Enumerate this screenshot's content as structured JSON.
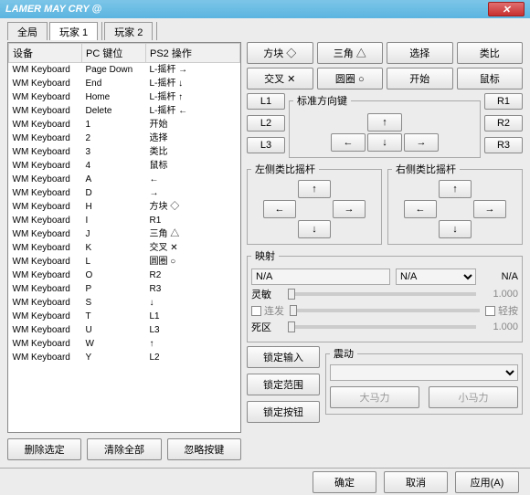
{
  "title": "LAMER MAY CRY @",
  "tabs": [
    "全局",
    "玩家 1",
    "玩家 2"
  ],
  "active_tab": 1,
  "columns": {
    "device": "设备",
    "pckey": "PC 键位",
    "ps2op": "PS2 操作"
  },
  "rows": [
    {
      "d": "WM Keyboard",
      "k": "Page Down",
      "o": "L-摇杆 →"
    },
    {
      "d": "WM Keyboard",
      "k": "End",
      "o": "L-摇杆 ↓"
    },
    {
      "d": "WM Keyboard",
      "k": "Home",
      "o": "L-摇杆 ↑"
    },
    {
      "d": "WM Keyboard",
      "k": "Delete",
      "o": "L-摇杆 ←"
    },
    {
      "d": "WM Keyboard",
      "k": "1",
      "o": "开始"
    },
    {
      "d": "WM Keyboard",
      "k": "2",
      "o": "选择"
    },
    {
      "d": "WM Keyboard",
      "k": "3",
      "o": "类比"
    },
    {
      "d": "WM Keyboard",
      "k": "4",
      "o": "鼠标"
    },
    {
      "d": "WM Keyboard",
      "k": "A",
      "o": "←"
    },
    {
      "d": "WM Keyboard",
      "k": "D",
      "o": "→"
    },
    {
      "d": "WM Keyboard",
      "k": "H",
      "o": "方块 ◇"
    },
    {
      "d": "WM Keyboard",
      "k": "I",
      "o": "R1"
    },
    {
      "d": "WM Keyboard",
      "k": "J",
      "o": "三角 △"
    },
    {
      "d": "WM Keyboard",
      "k": "K",
      "o": "交叉 ✕"
    },
    {
      "d": "WM Keyboard",
      "k": "L",
      "o": "圆圈 ○"
    },
    {
      "d": "WM Keyboard",
      "k": "O",
      "o": "R2"
    },
    {
      "d": "WM Keyboard",
      "k": "P",
      "o": "R3"
    },
    {
      "d": "WM Keyboard",
      "k": "S",
      "o": "↓"
    },
    {
      "d": "WM Keyboard",
      "k": "T",
      "o": "L1"
    },
    {
      "d": "WM Keyboard",
      "k": "U",
      "o": "L3"
    },
    {
      "d": "WM Keyboard",
      "k": "W",
      "o": "↑"
    },
    {
      "d": "WM Keyboard",
      "k": "Y",
      "o": "L2"
    }
  ],
  "left_btns": {
    "del_sel": "删除选定",
    "clear_all": "清除全部",
    "ignore": "忽略按键"
  },
  "face": {
    "square": "方块 ◇",
    "triangle": "三角 △",
    "select": "选择",
    "analog": "类比",
    "cross": "交叉 ✕",
    "circle": "圆圈 ○",
    "start": "开始",
    "mouse": "鼠标"
  },
  "dpad_legend": "标准方向键",
  "L1": "L1",
  "L2": "L2",
  "L3": "L3",
  "R1": "R1",
  "R2": "R2",
  "R3": "R3",
  "left_stick": "左侧类比摇杆",
  "right_stick": "右侧类比摇杆",
  "arrows": {
    "up": "↑",
    "down": "↓",
    "left": "←",
    "right": "→"
  },
  "mapping": {
    "legend": "映射",
    "na": "N/A",
    "sens": "灵敏",
    "sens_val": "1.000",
    "burst": "连发",
    "light": "轻按",
    "dead": "死区",
    "dead_val": "1.000"
  },
  "lock": {
    "input": "锁定输入",
    "range": "锁定范围",
    "button": "锁定按钮"
  },
  "vib": {
    "legend": "震动",
    "big": "大马力",
    "small": "小马力"
  },
  "footer": {
    "ok": "确定",
    "cancel": "取消",
    "apply": "应用(A)"
  }
}
